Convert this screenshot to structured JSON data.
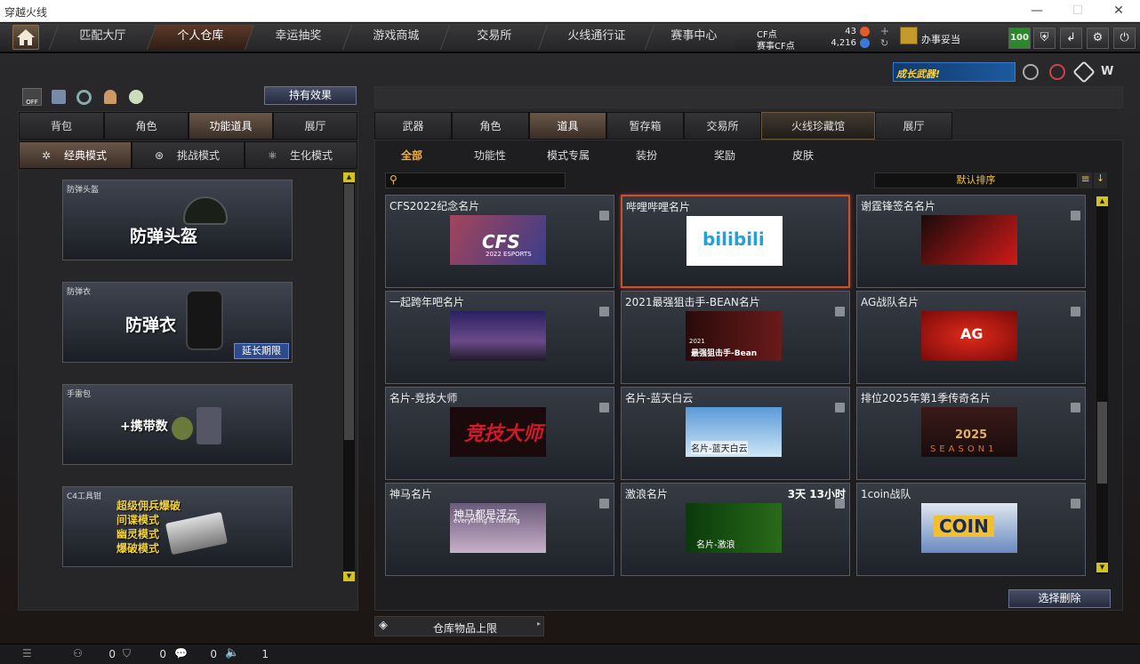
{
  "window": {
    "title": "穿越火线"
  },
  "nav": {
    "tabs": [
      "匹配大厅",
      "个人仓库",
      "幸运抽奖",
      "游戏商城",
      "交易所",
      "火线通行证",
      "赛事中心"
    ]
  },
  "currency": {
    "cf_label": "CF点",
    "cf_value": "43",
    "match_label": "赛事CF点",
    "match_value": "4,216"
  },
  "user": {
    "name": "办事妥当",
    "level": "100"
  },
  "promo": {
    "text": "成长武器!"
  },
  "left": {
    "effect_button": "持有效果",
    "tabs": [
      "背包",
      "角色",
      "功能道具",
      "展厅"
    ],
    "modes": [
      "经典模式",
      "挑战模式",
      "生化模式"
    ],
    "items": [
      {
        "label": "防弹头盔",
        "title": "防弹头盔"
      },
      {
        "label": "防弹衣",
        "title": "防弹衣",
        "button": "延长期限"
      },
      {
        "label": "手雷包",
        "title": "+携带数"
      },
      {
        "label": "C4工具钳",
        "lines": [
          "超级佣兵爆破",
          "间谍模式",
          "幽灵模式",
          "爆破模式"
        ]
      }
    ]
  },
  "right": {
    "tabs": [
      "武器",
      "角色",
      "道具",
      "暂存箱",
      "交易所",
      "火线珍藏馆",
      "展厅"
    ],
    "subtabs": [
      "全部",
      "功能性",
      "模式专属",
      "装扮",
      "奖励",
      "皮肤"
    ],
    "search_placeholder": "",
    "sort": "默认排序",
    "cards": [
      {
        "name": "CFS2022纪念名片",
        "pic": "CFS",
        "pic_sub": "2022 ESPORTS"
      },
      {
        "name": "哔哩哔哩名片",
        "pic": "bilibili"
      },
      {
        "name": "谢霆锋签名名片",
        "pic": ""
      },
      {
        "name": "一起跨年吧名片",
        "pic": ""
      },
      {
        "name": "2021最强狙击手-BEAN名片",
        "pic": "最强狙击手-Bean",
        "pic_sub": "2021"
      },
      {
        "name": "AG战队名片",
        "pic": "AG"
      },
      {
        "name": "名片-竞技大师",
        "pic": "竞技大师"
      },
      {
        "name": "名片-蓝天白云",
        "pic": "名片-蓝天白云"
      },
      {
        "name": "排位2025年第1季传奇名片",
        "pic": "2025",
        "pic_sub": "SEASON1"
      },
      {
        "name": "神马名片",
        "pic": "神马都是浮云",
        "pic_sub": "everything is nothing"
      },
      {
        "name": "激浪名片",
        "pic": "名片-激浪",
        "time": "3天 13小时"
      },
      {
        "name": "1coin战队",
        "pic": "COIN"
      }
    ],
    "select_delete": "选择删除",
    "storage_limit": "仓库物品上限"
  },
  "status": {
    "v1": "0",
    "v2": "0",
    "v3": "0",
    "v4": "1"
  }
}
